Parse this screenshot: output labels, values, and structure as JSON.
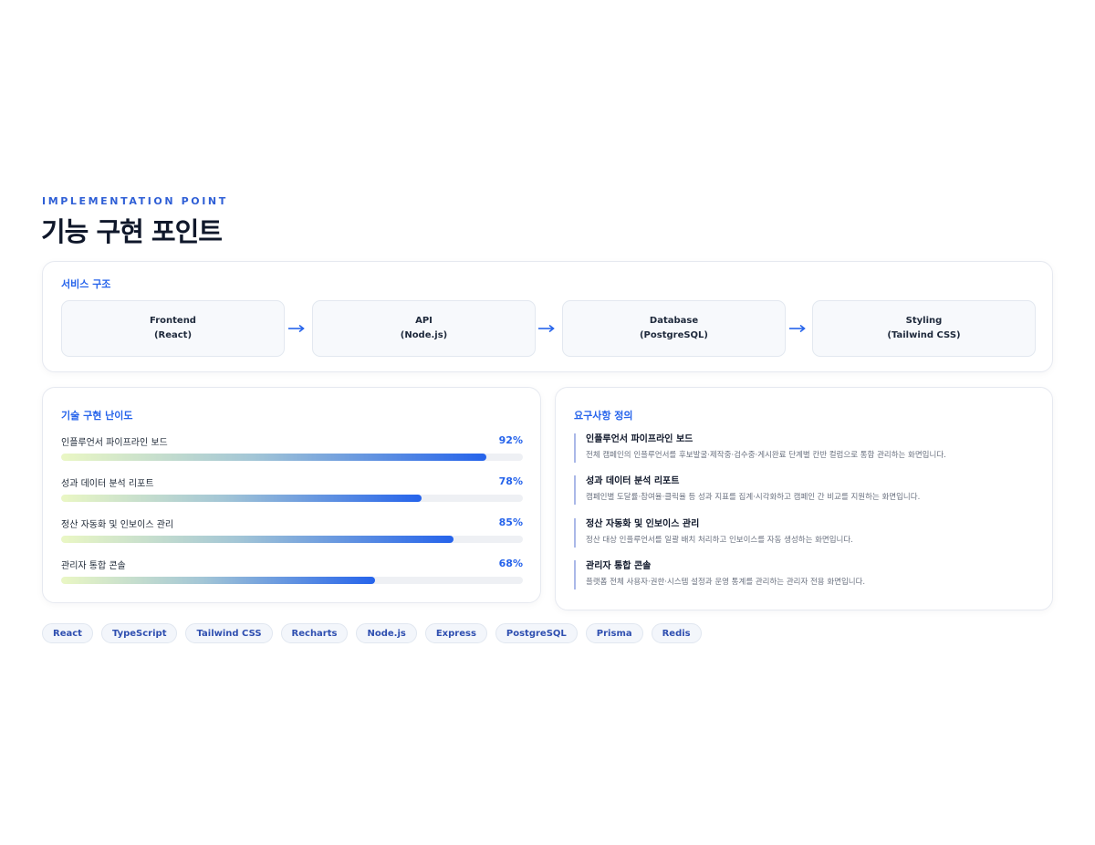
{
  "header": {
    "eyebrow": "IMPLEMENTATION POINT",
    "title": "기능 구현 포인트"
  },
  "service": {
    "title": "서비스 구조",
    "nodes": [
      {
        "name": "Frontend",
        "tech": "(React)"
      },
      {
        "name": "API",
        "tech": "(Node.js)"
      },
      {
        "name": "Database",
        "tech": "(PostgreSQL)"
      },
      {
        "name": "Styling",
        "tech": "(Tailwind CSS)"
      }
    ]
  },
  "difficulty": {
    "title": "기술 구현 난이도",
    "items": [
      {
        "label": "인플루언서 파이프라인 보드",
        "value": "92%",
        "fraction": 0.92
      },
      {
        "label": "성과 데이터 분석 리포트",
        "value": "78%",
        "fraction": 0.78
      },
      {
        "label": "정산 자동화 및 인보이스 관리",
        "value": "85%",
        "fraction": 0.85
      },
      {
        "label": "관리자 통합 콘솔",
        "value": "68%",
        "fraction": 0.68
      }
    ]
  },
  "requirements": {
    "title": "요구사항 정의",
    "items": [
      {
        "title": "인플루언서 파이프라인 보드",
        "desc": "전체 캠페인의 인플루언서를 후보발굴·제작중·검수중·게시완료 단계별 칸반 컬럼으로 통합 관리하는 화면입니다."
      },
      {
        "title": "성과 데이터 분석 리포트",
        "desc": "캠페인별 도달률·참여율·클릭율 등 성과 지표를 집계·시각화하고 캠페인 간 비교를 지원하는 화면입니다."
      },
      {
        "title": "정산 자동화 및 인보이스 관리",
        "desc": "정산 대상 인플루언서를 일괄 배치 처리하고 인보이스를 자동 생성하는 화면입니다."
      },
      {
        "title": "관리자 통합 콘솔",
        "desc": "플랫폼 전체 사용자·권한·시스템 설정과 운영 통계를 관리하는 관리자 전용 화면입니다."
      }
    ]
  },
  "tags": [
    "React",
    "TypeScript",
    "Tailwind CSS",
    "Recharts",
    "Node.js",
    "Express",
    "PostgreSQL",
    "Prisma",
    "Redis"
  ],
  "colors": {
    "accent": "#2563eb",
    "bar_start": "#eaf7c4",
    "bar_end": "#2563eb"
  },
  "icons": {
    "flow_arrow": "arrow-right-icon"
  }
}
